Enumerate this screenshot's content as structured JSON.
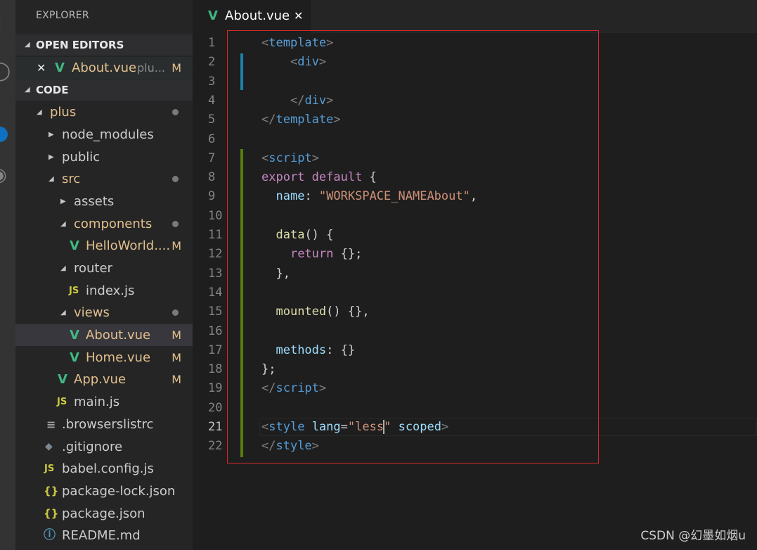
{
  "explorer": {
    "title": "EXPLORER",
    "open_editors": {
      "header": "OPEN EDITORS",
      "items": [
        {
          "name": "About.vue",
          "path_hint": "plu...",
          "badge": "M"
        }
      ]
    },
    "workspace": {
      "header": "CODE",
      "tree": [
        {
          "name": "plus",
          "type": "folder",
          "expanded": true,
          "modified": true
        },
        {
          "name": "node_modules",
          "type": "folder",
          "expanded": false
        },
        {
          "name": "public",
          "type": "folder",
          "expanded": false
        },
        {
          "name": "src",
          "type": "folder",
          "expanded": true,
          "modified": true
        },
        {
          "name": "assets",
          "type": "folder",
          "expanded": false
        },
        {
          "name": "components",
          "type": "folder",
          "expanded": true,
          "modified": true
        },
        {
          "name": "HelloWorld....",
          "type": "vue",
          "badge": "M"
        },
        {
          "name": "router",
          "type": "folder",
          "expanded": true
        },
        {
          "name": "index.js",
          "type": "js"
        },
        {
          "name": "views",
          "type": "folder",
          "expanded": true,
          "modified": true
        },
        {
          "name": "About.vue",
          "type": "vue",
          "badge": "M",
          "selected": true
        },
        {
          "name": "Home.vue",
          "type": "vue",
          "badge": "M"
        },
        {
          "name": "App.vue",
          "type": "vue",
          "badge": "M"
        },
        {
          "name": "main.js",
          "type": "js"
        },
        {
          "name": ".browserslistrc",
          "type": "text"
        },
        {
          "name": ".gitignore",
          "type": "git"
        },
        {
          "name": "babel.config.js",
          "type": "js"
        },
        {
          "name": "package-lock.json",
          "type": "json"
        },
        {
          "name": "package.json",
          "type": "json"
        },
        {
          "name": "README.md",
          "type": "info"
        }
      ]
    }
  },
  "tab": {
    "name": "About.vue",
    "close_glyph": "✕"
  },
  "editor": {
    "line_numbers": [
      "1",
      "2",
      "3",
      "4",
      "5",
      "6",
      "7",
      "8",
      "9",
      "10",
      "11",
      "12",
      "13",
      "14",
      "15",
      "16",
      "17",
      "18",
      "19",
      "20",
      "21",
      "22"
    ],
    "current_line": 21,
    "lines": [
      [
        [
          "tag",
          "<"
        ],
        [
          "el",
          "template"
        ],
        [
          "tag",
          ">"
        ]
      ],
      [
        [
          "p",
          "    "
        ],
        [
          "tag",
          "<"
        ],
        [
          "el",
          "div"
        ],
        [
          "tag",
          ">"
        ]
      ],
      [],
      [
        [
          "p",
          "    "
        ],
        [
          "tag",
          "</"
        ],
        [
          "el",
          "div"
        ],
        [
          "tag",
          ">"
        ]
      ],
      [
        [
          "tag",
          "</"
        ],
        [
          "el",
          "template"
        ],
        [
          "tag",
          ">"
        ]
      ],
      [],
      [
        [
          "tag",
          "<"
        ],
        [
          "el",
          "script"
        ],
        [
          "tag",
          ">"
        ]
      ],
      [
        [
          "kw",
          "export"
        ],
        [
          "p",
          " "
        ],
        [
          "kw",
          "default"
        ],
        [
          "p",
          " {"
        ]
      ],
      [
        [
          "p",
          "  "
        ],
        [
          "prop",
          "name"
        ],
        [
          "p",
          ": "
        ],
        [
          "str",
          "\"WORKSPACE_NAMEAbout\""
        ],
        [
          "p",
          ","
        ]
      ],
      [],
      [
        [
          "p",
          "  "
        ],
        [
          "fn",
          "data"
        ],
        [
          "p",
          "() {"
        ]
      ],
      [
        [
          "p",
          "    "
        ],
        [
          "kw",
          "return"
        ],
        [
          "p",
          " {};"
        ]
      ],
      [
        [
          "p",
          "  },"
        ]
      ],
      [],
      [
        [
          "p",
          "  "
        ],
        [
          "fn",
          "mounted"
        ],
        [
          "p",
          "() {},"
        ]
      ],
      [],
      [
        [
          "p",
          "  "
        ],
        [
          "prop",
          "methods"
        ],
        [
          "p",
          ": {}"
        ]
      ],
      [
        [
          "p",
          "};"
        ]
      ],
      [
        [
          "tag",
          "</"
        ],
        [
          "el",
          "script"
        ],
        [
          "tag",
          ">"
        ]
      ],
      [],
      [
        [
          "tag",
          "<"
        ],
        [
          "el",
          "style"
        ],
        [
          "p",
          " "
        ],
        [
          "attr",
          "lang"
        ],
        [
          "p",
          "="
        ],
        [
          "str",
          "\"less"
        ],
        [
          "caret",
          ""
        ],
        [
          "str",
          "\""
        ],
        [
          "p",
          " "
        ],
        [
          "attr",
          "scoped"
        ],
        [
          "tag",
          ">"
        ]
      ],
      [
        [
          "tag",
          "</"
        ],
        [
          "el",
          "style"
        ],
        [
          "tag",
          ">"
        ]
      ]
    ]
  },
  "colors": {
    "accent_vue": "#41b883",
    "modified": "#e2c08d",
    "highlight_box": "#d9282c"
  },
  "watermark": "CSDN @幻墨如烟u"
}
